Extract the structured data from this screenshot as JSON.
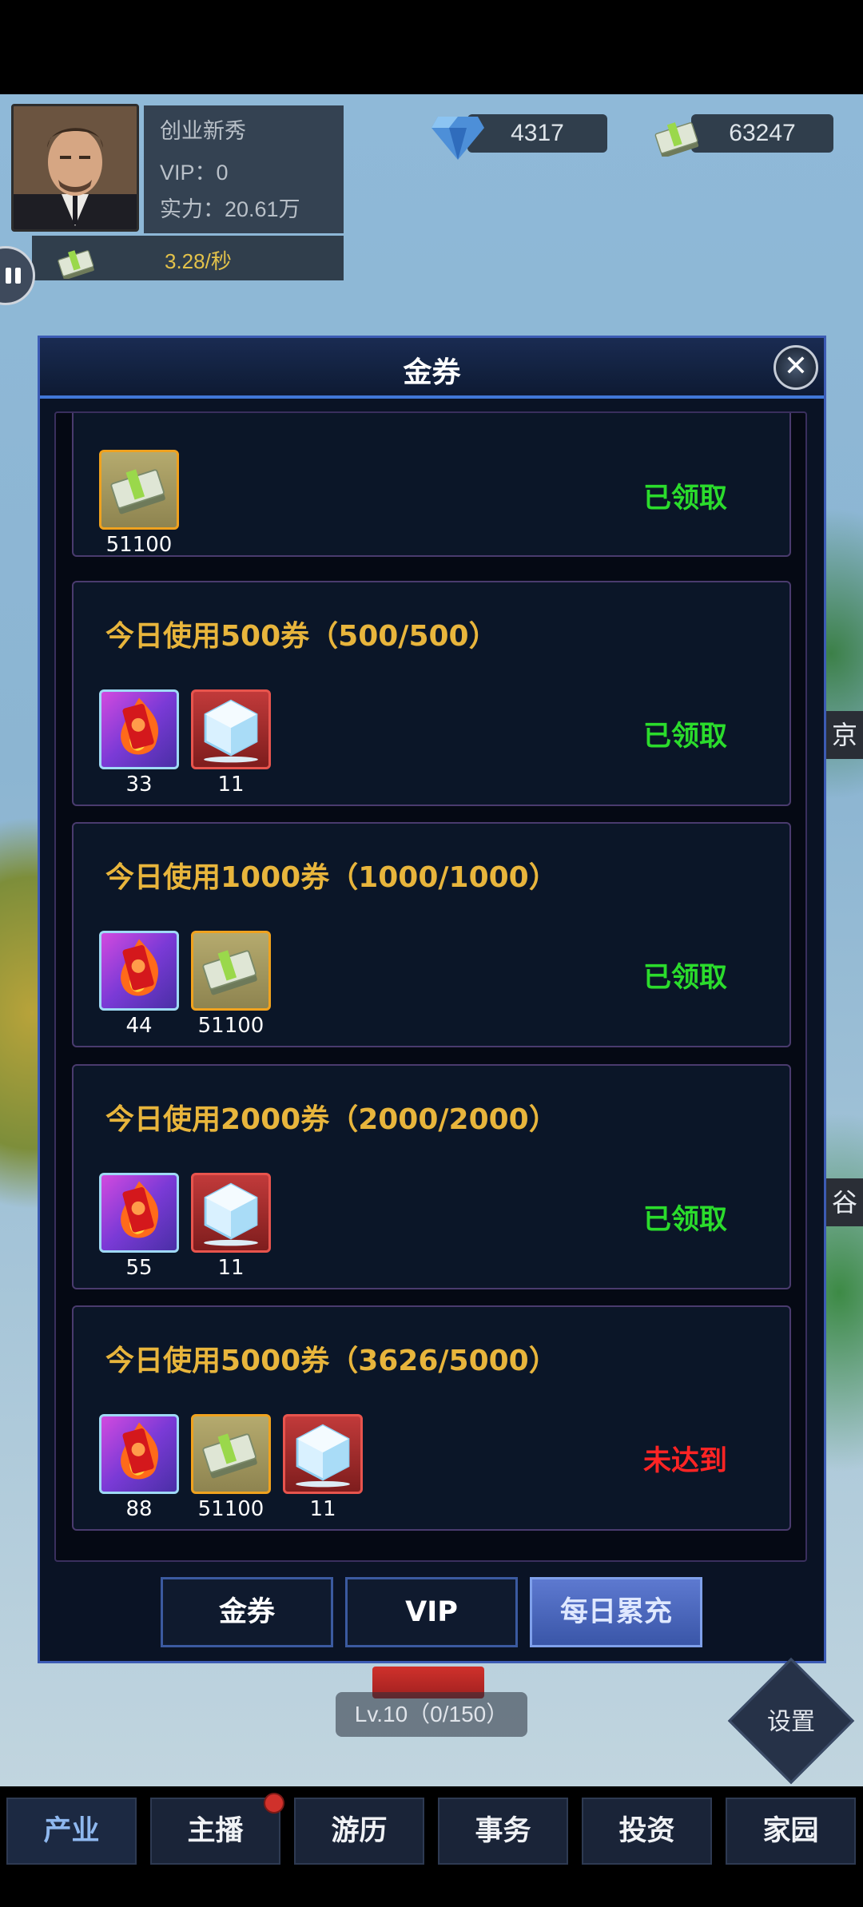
{
  "player": {
    "name": "创业新秀",
    "vip": "VIP：0",
    "power": "实力：20.61万",
    "income": "3.28/秒"
  },
  "resources": {
    "diamonds": "4317",
    "cash": "63247"
  },
  "modal": {
    "title": "金券",
    "close_icon": "close-icon",
    "rewards": [
      {
        "title": "",
        "items": [
          {
            "icon": "cash-stack-icon",
            "count": "51100"
          }
        ],
        "status": "已领取"
      },
      {
        "title": "今日使用500券（500/500）",
        "items": [
          {
            "icon": "fire-ticket-icon",
            "count": "33"
          },
          {
            "icon": "ice-cube-icon",
            "count": "11"
          }
        ],
        "status": "已领取"
      },
      {
        "title": "今日使用1000券（1000/1000）",
        "items": [
          {
            "icon": "fire-ticket-icon",
            "count": "44"
          },
          {
            "icon": "cash-stack-icon",
            "count": "51100"
          }
        ],
        "status": "已领取"
      },
      {
        "title": "今日使用2000券（2000/2000）",
        "items": [
          {
            "icon": "fire-ticket-icon",
            "count": "55"
          },
          {
            "icon": "ice-cube-icon",
            "count": "11"
          }
        ],
        "status": "已领取"
      },
      {
        "title": "今日使用5000券（3626/5000）",
        "items": [
          {
            "icon": "fire-ticket-icon",
            "count": "88"
          },
          {
            "icon": "cash-stack-icon",
            "count": "51100"
          },
          {
            "icon": "ice-cube-icon",
            "count": "11"
          }
        ],
        "status": "未达到"
      }
    ],
    "tabs": [
      {
        "label": "金券",
        "active": false
      },
      {
        "label": "VIP",
        "active": false
      },
      {
        "label": "每日累充",
        "active": true
      }
    ]
  },
  "hud": {
    "level": "Lv.10（0/150）",
    "settings": "设置",
    "side_labels": [
      "京",
      "谷"
    ]
  },
  "nav": [
    {
      "label": "产业",
      "active": true
    },
    {
      "label": "主播",
      "active": false,
      "badge": true
    },
    {
      "label": "游历",
      "active": false
    },
    {
      "label": "事务",
      "active": false
    },
    {
      "label": "投资",
      "active": false
    },
    {
      "label": "家园",
      "active": false
    }
  ],
  "colors": {
    "claimed": "#2bdc2c",
    "not_reached": "#ff2424",
    "title_gold": "#e8b53c",
    "modal_border": "#3c5bb4"
  }
}
